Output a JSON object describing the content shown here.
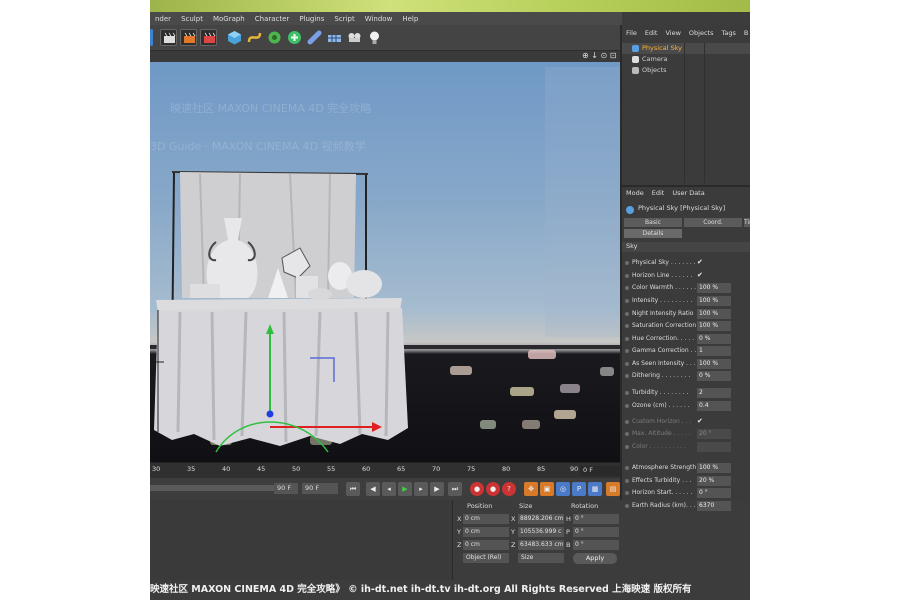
{
  "menubar": [
    "nder",
    "Sculpt",
    "MoGraph",
    "Character",
    "Plugins",
    "Script",
    "Window",
    "Help"
  ],
  "viewport": {
    "watermark_1": "映速社区 MAXON CINEMA 4D 完全攻略",
    "watermark_2": "3D  Guide · MAXON CINEMA 4D 视频教学",
    "header_icons": "⊕ ↓ ⊙ ⊡"
  },
  "timeline": {
    "ticks": [
      "30",
      "35",
      "40",
      "45",
      "50",
      "55",
      "60",
      "65",
      "70",
      "75",
      "80",
      "85",
      "90"
    ],
    "current_frame": "0 F",
    "end_field_1": "90 F",
    "end_field_2": "90 F"
  },
  "coords": {
    "headers": [
      "Position",
      "Size",
      "Rotation"
    ],
    "rows": [
      {
        "axis": "X",
        "pos": "0 cm",
        "size_axis": "X",
        "size": "88928.206 cm",
        "rot_axis": "H",
        "rot": "0 °"
      },
      {
        "axis": "Y",
        "pos": "0 cm",
        "size_axis": "Y",
        "size": "105536.999 c",
        "rot_axis": "P",
        "rot": "0 °"
      },
      {
        "axis": "Z",
        "pos": "0 cm",
        "size_axis": "Z",
        "size": "63483.633 cm",
        "rot_axis": "B",
        "rot": "0 °"
      }
    ],
    "mode_select": "Object (Rel)",
    "size_select": "Size",
    "apply_label": "Apply"
  },
  "object_manager": {
    "menu": [
      "File",
      "Edit",
      "View",
      "Objects",
      "Tags",
      "B"
    ],
    "objects": [
      {
        "name": "Physical Sky",
        "color": "#ffb23a"
      },
      {
        "name": "Camera",
        "color": "#dddddd"
      },
      {
        "name": "Objects",
        "color": "#dddddd"
      }
    ]
  },
  "attributes": {
    "menu": [
      "Mode",
      "Edit",
      "User Data"
    ],
    "title": "Physical Sky [Physical Sky]",
    "tabs": [
      "Basic",
      "Coord.",
      "Tim",
      "Details"
    ],
    "section": "Sky",
    "params": [
      {
        "label": "Physical Sky . . . . . . .",
        "value": "✔",
        "check": true,
        "dim": false
      },
      {
        "label": "Horizon Line . . . . . .",
        "value": "✔",
        "check": true,
        "dim": false
      },
      {
        "label": "Color Warmth . . . . . .",
        "value": "100 %",
        "check": false,
        "dim": false
      },
      {
        "label": "Intensity . . . . . . . . .",
        "value": "100 %",
        "check": false,
        "dim": false
      },
      {
        "label": "Night Intensity Ratio",
        "value": "100 %",
        "check": false,
        "dim": false
      },
      {
        "label": "Saturation Correction",
        "value": "100 %",
        "check": false,
        "dim": false
      },
      {
        "label": "Hue Correction. . . . .",
        "value": "0 %",
        "check": false,
        "dim": false
      },
      {
        "label": "Gamma Correction . .",
        "value": "1",
        "check": false,
        "dim": false
      },
      {
        "label": "As Seen Intensity . . .",
        "value": "100 %",
        "check": false,
        "dim": false
      },
      {
        "label": "Dithering . . . . . . . .",
        "value": "0 %",
        "check": false,
        "dim": false
      },
      {
        "label": "Turbidity . . . . . . . .",
        "value": "2",
        "check": false,
        "dim": false
      },
      {
        "label": "Ozone (cm) . . . . . .",
        "value": "0.4",
        "check": false,
        "dim": false
      },
      {
        "label": "Custom Horizon . . .",
        "value": "✔",
        "check": true,
        "dim": true
      },
      {
        "label": "Max. Altitude . . . . .",
        "value": "20 °",
        "check": false,
        "dim": true
      },
      {
        "label": "Color . . . . . . . . . .",
        "value": "",
        "check": false,
        "dim": true
      },
      {
        "label": "Atmosphere Strength",
        "value": "100 %",
        "check": false,
        "dim": false
      },
      {
        "label": "Effects Turbidity . . .",
        "value": "20 %",
        "check": false,
        "dim": false
      },
      {
        "label": "Horizon Start. . . . . .",
        "value": "0 °",
        "check": false,
        "dim": false
      },
      {
        "label": "Earth Radius (km). . .",
        "value": "6370",
        "check": false,
        "dim": false
      }
    ]
  },
  "caption": "映速社区 MAXON CINEMA 4D 完全攻略》 © ih-dt.net ih-dt.tv  ih-dt.org  All Rights Reserved 上海映速 版权所有"
}
